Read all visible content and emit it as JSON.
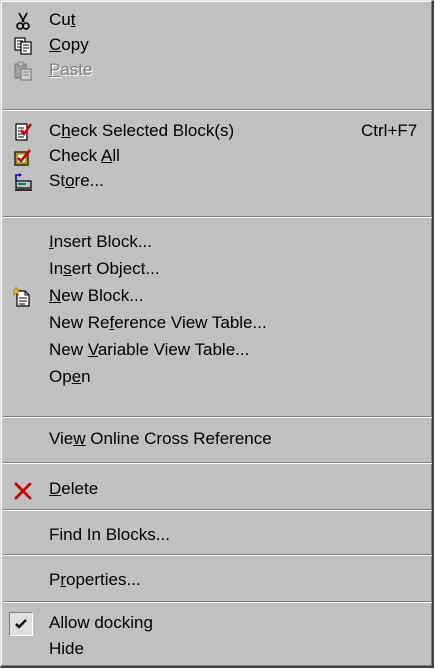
{
  "menu": {
    "cut": {
      "pre": "Cu",
      "key": "t",
      "post": "",
      "icon": "scissors-icon"
    },
    "copy": {
      "pre": "",
      "key": "C",
      "post": "opy",
      "icon": "copy-icon"
    },
    "paste": {
      "pre": "",
      "key": "P",
      "post": "aste",
      "icon": "paste-icon",
      "disabled": true
    },
    "check_selected": {
      "pre": "C",
      "key": "h",
      "post": "eck Selected Block(s)",
      "shortcut": "Ctrl+F7",
      "icon": "check-document-icon"
    },
    "check_all": {
      "pre": "Check ",
      "key": "A",
      "post": "ll",
      "icon": "check-all-icon"
    },
    "store": {
      "pre": "St",
      "key": "o",
      "post": "re...",
      "icon": "store-icon"
    },
    "insert_block": {
      "pre": "",
      "key": "I",
      "post": "nsert Block..."
    },
    "insert_object": {
      "pre": "In",
      "key": "s",
      "post": "ert Object..."
    },
    "new_block": {
      "pre": "",
      "key": "N",
      "post": "ew Block...",
      "icon": "new-block-icon"
    },
    "new_reference": {
      "pre": "New Re",
      "key": "f",
      "post": "erence View Table..."
    },
    "new_variable": {
      "pre": "New ",
      "key": "V",
      "post": "ariable View Table..."
    },
    "open": {
      "pre": "Op",
      "key": "e",
      "post": "n"
    },
    "view_online": {
      "pre": "Vie",
      "key": "w",
      "post": " Online Cross Reference"
    },
    "delete": {
      "pre": "",
      "key": "D",
      "post": "elete",
      "icon": "delete-x-icon"
    },
    "find": {
      "pre": "Find In Blocks...",
      "key": "",
      "post": ""
    },
    "properties": {
      "pre": "P",
      "key": "r",
      "post": "operties..."
    },
    "allow_docking": {
      "pre": "Allow docking",
      "key": "",
      "post": "",
      "checked": true,
      "icon": "checkmark-icon"
    },
    "hide": {
      "pre": "Hide",
      "key": "",
      "post": ""
    }
  },
  "colors": {
    "menu_bg": "#c0c0c0",
    "disabled_text": "#808080",
    "delete_red": "#cc0000"
  }
}
